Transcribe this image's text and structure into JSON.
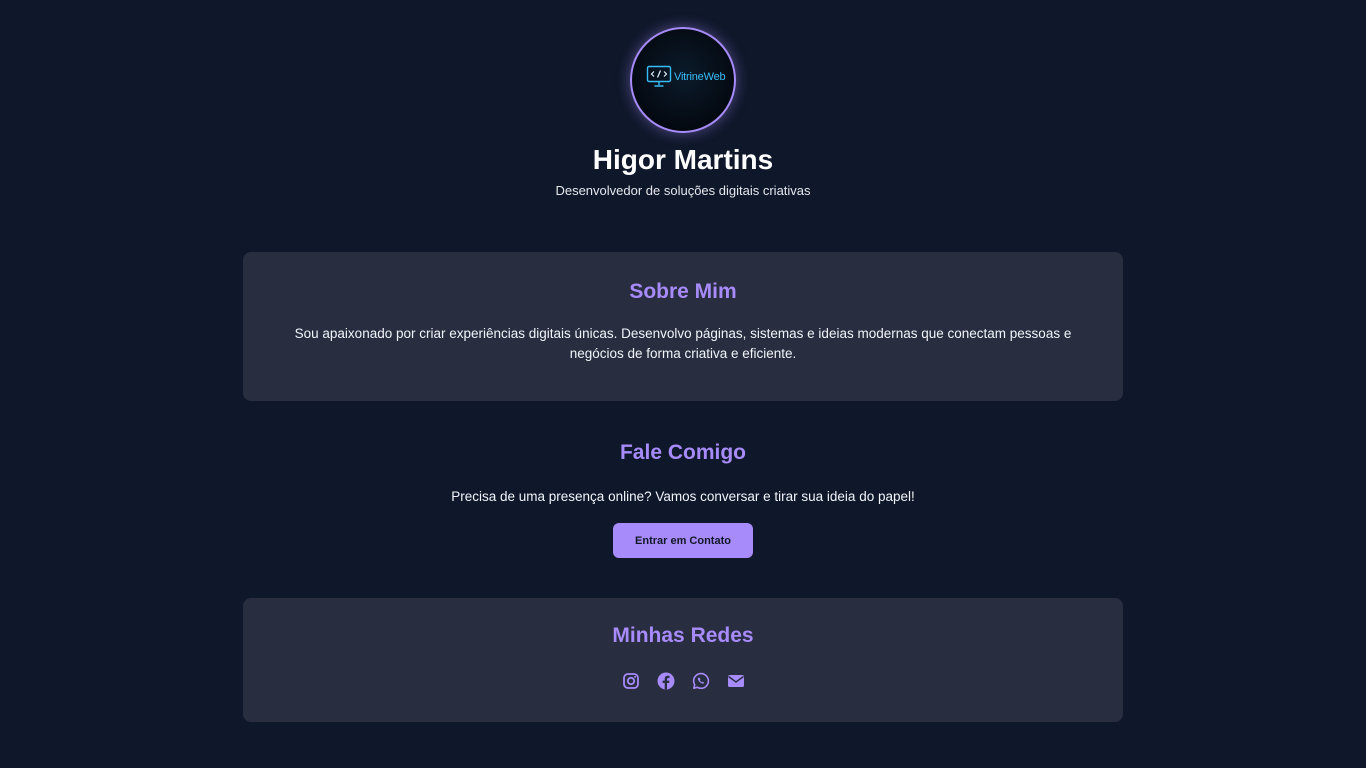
{
  "profile": {
    "logo_text": "VitrineWeb",
    "name": "Higor Martins",
    "tagline": "Desenvolvedor de soluções digitais criativas"
  },
  "about": {
    "title": "Sobre Mim",
    "text": "Sou apaixonado por criar experiências digitais únicas. Desenvolvo páginas, sistemas e ideias modernas que conectam pessoas e negócios de forma criativa e eficiente."
  },
  "contact": {
    "title": "Fale Comigo",
    "text": "Precisa de uma presença online? Vamos conversar e tirar sua ideia do papel!",
    "button_label": "Entrar em Contato"
  },
  "social": {
    "title": "Minhas Redes",
    "links": [
      {
        "icon": "instagram-icon"
      },
      {
        "icon": "facebook-icon"
      },
      {
        "icon": "whatsapp-icon"
      },
      {
        "icon": "envelope-icon"
      }
    ]
  },
  "colors": {
    "background": "#0f172a",
    "card": "#282d40",
    "accent": "#a78bfa",
    "logo_accent": "#38bdf8"
  }
}
